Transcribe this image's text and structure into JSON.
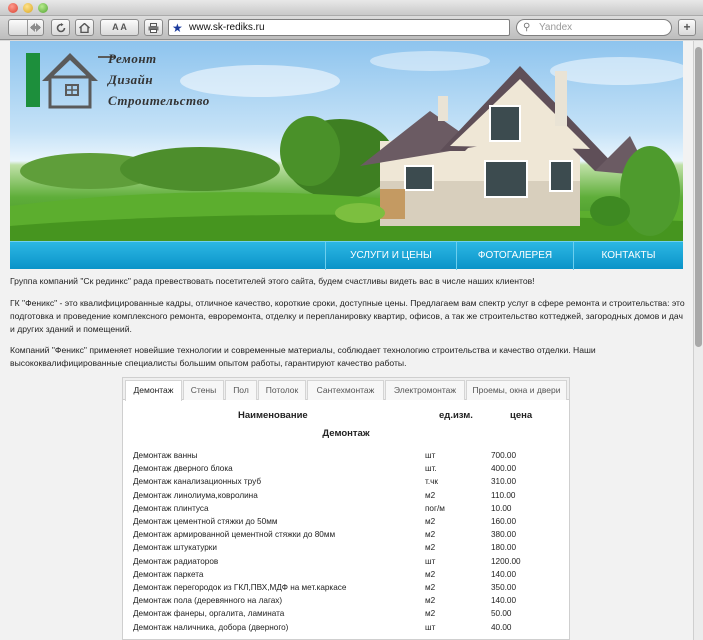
{
  "browser": {
    "url": "www.sk-rediks.ru",
    "search_placeholder": "Yandex",
    "text_size_label": "A A"
  },
  "logo": {
    "line1": "Ремонт",
    "line2": "Дизайн",
    "line3": "Строительство"
  },
  "nav": {
    "items": [
      "УСЛУГИ И ЦЕНЫ",
      "ФОТОГАЛЕРЕЯ",
      "КОНТАКТЫ"
    ]
  },
  "intro": {
    "p1": "Группа компаний \"Ск рединкс\" рада превествовать посетителей этого сайта, будем счастливы видеть вас в числе наших клиентов!",
    "p2": "ГК \"Феникс\" - это квалифицированные кадры, отличное качество, короткие сроки, доступные цены. Предлагаем вам спектр услуг в сфере ремонта и строительства: это подготовка и проведение комплексного ремонта, евроремонта, отделку и перепланировку квартир, офисов, а так же строительство коттеджей, загородных домов и дач и других зданий и помещений.",
    "p3": "Компаний \"Феникс\" применяет новейшие технологии и современные материалы, соблюдает технологию строительства и качество отделки. Наши высококвалифицированные специалисты большим опытом работы, гарантируют качество работы."
  },
  "tabs": [
    "Демонтаж",
    "Стены",
    "Пол",
    "Потолок",
    "Сантехмонтаж",
    "Электромонтаж",
    "Проемы, окна и двери"
  ],
  "active_tab": "Демонтаж",
  "table": {
    "headers": [
      "Наименование",
      "ед.изм.",
      "цена"
    ],
    "section": "Демонтаж",
    "rows": [
      [
        "Демонтаж  ванны",
        "шт",
        "700.00"
      ],
      [
        "Демонтаж дверного блока",
        "шт.",
        "400.00"
      ],
      [
        "Демонтаж канализационных труб",
        "т.чк",
        "310.00"
      ],
      [
        "Демонтаж линолиума,ковролина",
        "м2",
        "110.00"
      ],
      [
        "Демонтаж плинтуса",
        "пог/м",
        "10.00"
      ],
      [
        "Демонтаж цементной стяжки до 50мм",
        "м2",
        "160.00"
      ],
      [
        "Демонтаж армированной цементной стяжки до 80мм",
        "м2",
        "380.00"
      ],
      [
        "Демонтаж штукатурки",
        "м2",
        "180.00"
      ],
      [
        "Демонтаж радиаторов",
        "шт",
        "1200.00"
      ],
      [
        "Демонтаж паркета",
        "м2",
        "140.00"
      ],
      [
        "Демонтаж перегородок из ГКЛ,ПВХ,МДФ на мет.каркасе",
        "м2",
        "350.00"
      ],
      [
        "Демонтаж пола (деревянного на лагах)",
        "м2",
        "140.00"
      ],
      [
        "Демонтаж фанеры, оргалита, ламината",
        "м2",
        "50.00"
      ],
      [
        "Демонтаж наличника, добора (дверного)",
        "шт",
        "40.00"
      ]
    ]
  }
}
